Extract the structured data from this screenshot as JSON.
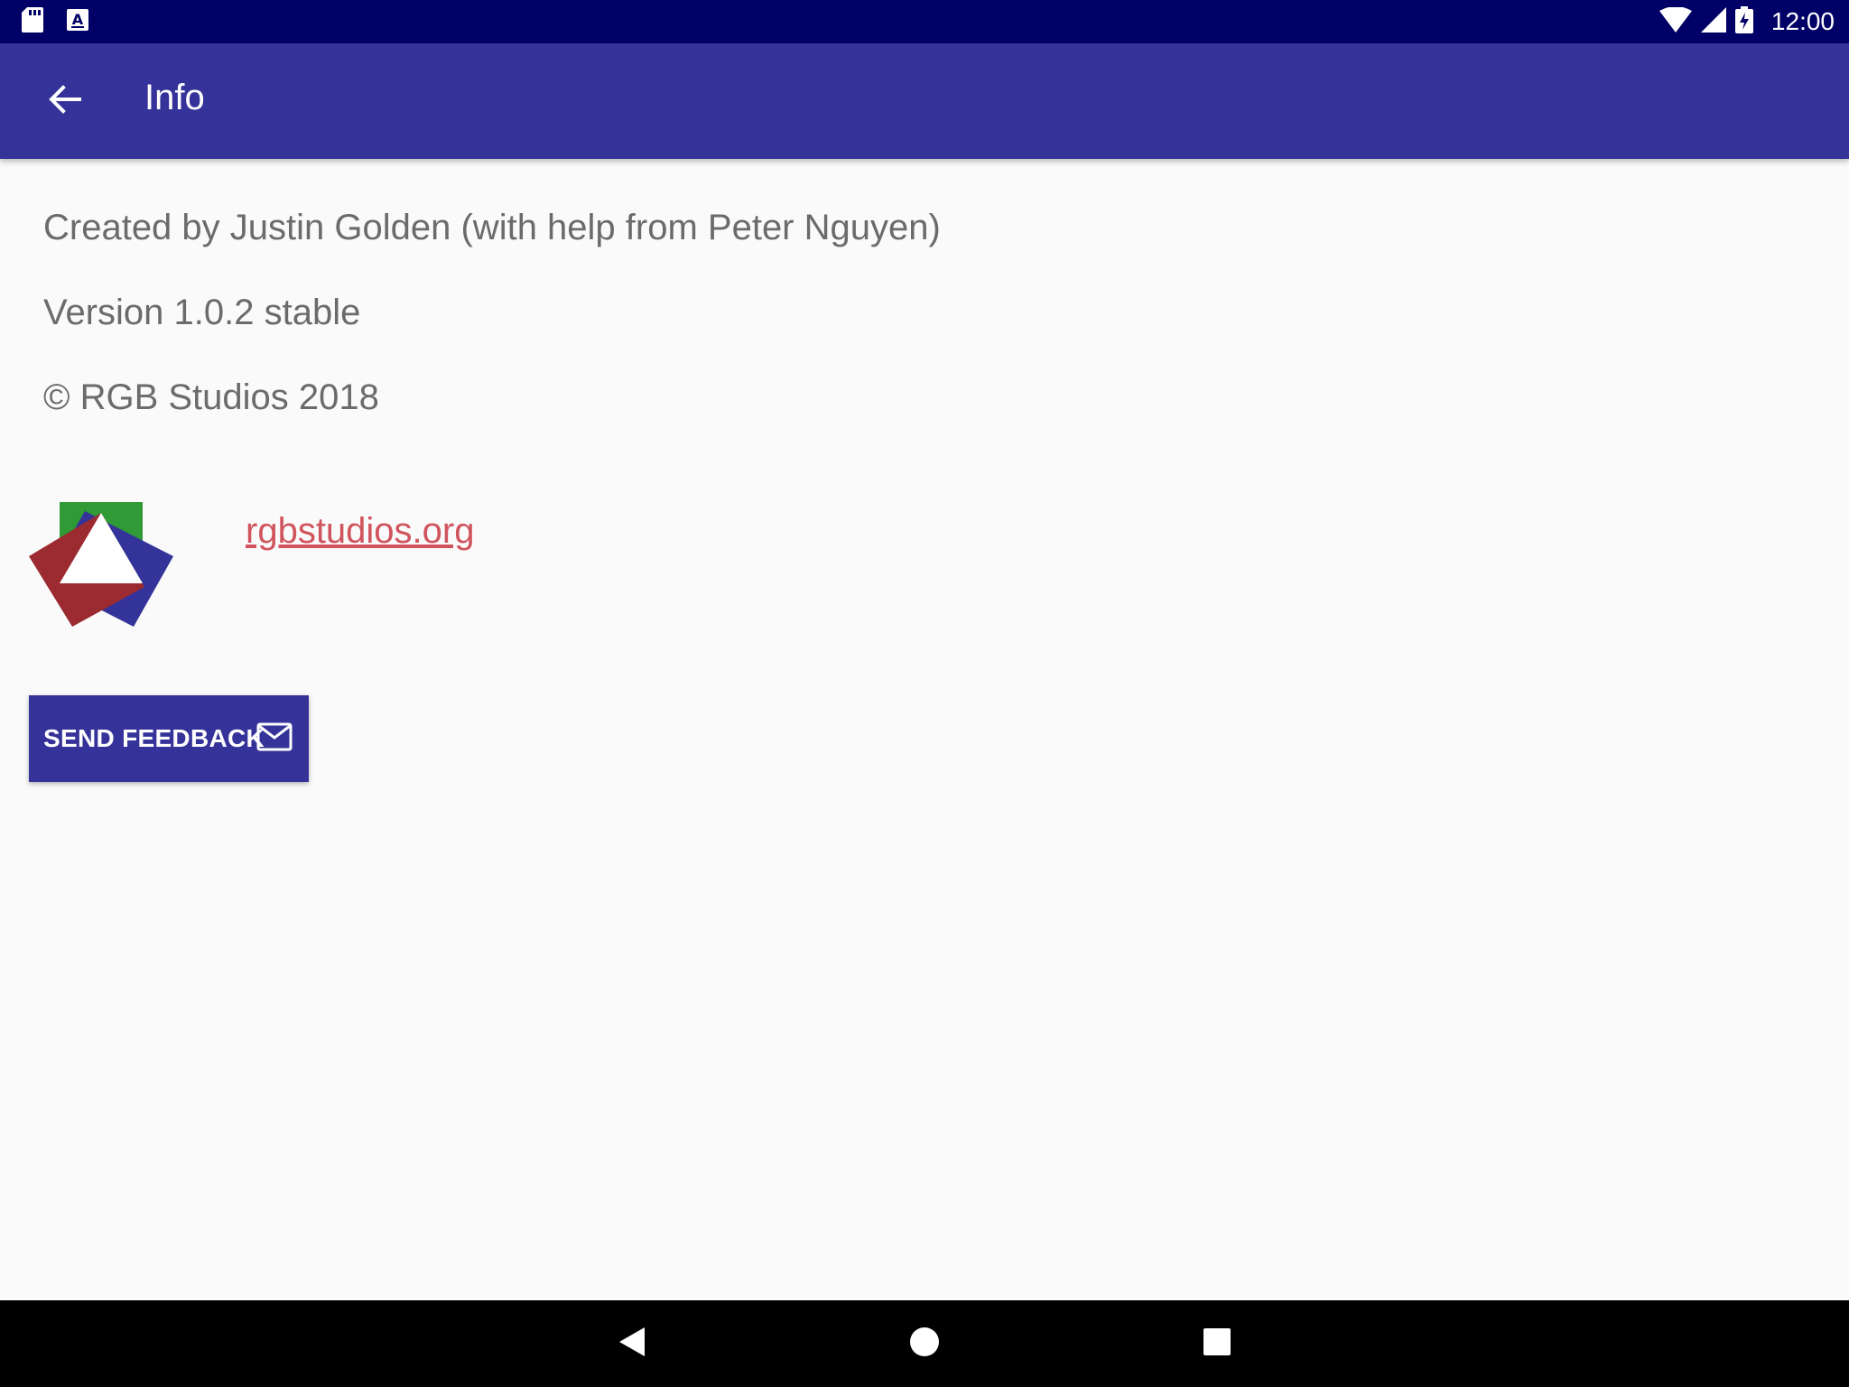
{
  "status_bar": {
    "time": "12:00",
    "left_icons": [
      "sd-card-icon",
      "keyboard-a-icon"
    ],
    "right_icons": [
      "wifi-icon",
      "cell-signal-icon",
      "battery-charging-icon"
    ]
  },
  "app_bar": {
    "title": "Info",
    "back_icon": "arrow-back-icon"
  },
  "content": {
    "created_by": "Created by Justin Golden (with help from Peter Nguyen)",
    "version": "Version 1.0.2 stable",
    "copyright": "© RGB Studios 2018",
    "website_link": "rgbstudios.org",
    "feedback_button": "SEND FEEDBACK",
    "feedback_icon": "mail-icon"
  },
  "nav_bar": {
    "icons": [
      "back-triangle-icon",
      "home-circle-icon",
      "recents-square-icon"
    ]
  },
  "colors": {
    "status_bar": "#000066",
    "app_bar": "#353399",
    "background": "#fafafa",
    "text": "#6b6b6b",
    "link": "#d0545e",
    "logo_green": "#2f9a36",
    "logo_red": "#9b2a31",
    "logo_blue": "#333399"
  }
}
